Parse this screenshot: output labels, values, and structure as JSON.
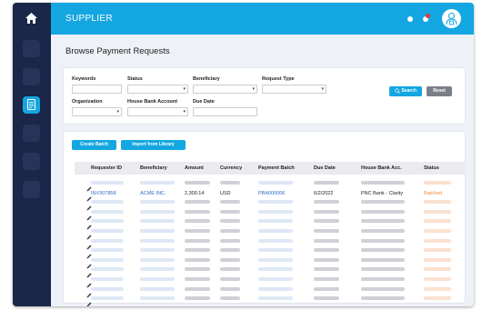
{
  "app": {
    "title": "SUPPLIER"
  },
  "page": {
    "title": "Browse Payment Requests"
  },
  "filters": {
    "keywords_label": "Keywords",
    "status_label": "Status",
    "beneficiary_label": "Beneficiary",
    "request_type_label": "Request Type",
    "organization_label": "Organization",
    "house_bank_label": "House Bank Account",
    "due_date_label": "Due Date",
    "search_label": "Search",
    "reset_label": "Reset"
  },
  "actions": {
    "create_batch": "Create Batch",
    "import_library": "Import from Library"
  },
  "table": {
    "columns": [
      "Requester ID",
      "Beneficiary",
      "Amount",
      "Currency",
      "Payment Batch",
      "Due Date",
      "House Bank Acc.",
      "Status"
    ],
    "rows": [
      {
        "requester_id": "INV307858",
        "beneficiary": "ACME INC.",
        "amount": "2,300.14",
        "currency": "USD",
        "payment_batch": "PBA000006",
        "due_date": "6/2/2022",
        "house_bank": "PNC Bank - Clarity",
        "status": "Batched"
      }
    ],
    "placeholder_row_count": 11
  },
  "icons": {
    "home": "home-icon",
    "doc": "document-icon",
    "user": "user-icon",
    "edit": "pencil-icon",
    "search": "search-icon",
    "chevron": "chevron-down-icon"
  },
  "colors": {
    "accent": "#14a6e1",
    "sidebar": "#1a2748",
    "link": "#2a6cc7",
    "status_batched": "#f08a3c",
    "badge": "#e23c3c"
  }
}
